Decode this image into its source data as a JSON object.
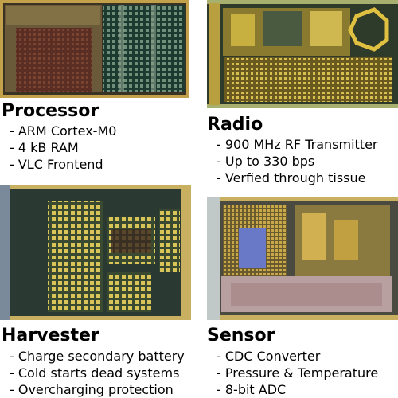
{
  "panels": {
    "processor": {
      "title": "Processor",
      "items": [
        "ARM Cortex-M0",
        "4 kB RAM",
        "VLC Frontend"
      ]
    },
    "radio": {
      "title": "Radio",
      "items": [
        "900 MHz RF Transmitter",
        "Up to 330 bps",
        "Verfied through tissue"
      ]
    },
    "harvester": {
      "title": "Harvester",
      "items": [
        "Charge secondary battery",
        "Cold starts dead systems",
        "Overcharging protection"
      ]
    },
    "sensor": {
      "title": "Sensor",
      "items": [
        "CDC Converter",
        "Pressure & Temperature",
        "8-bit ADC"
      ]
    }
  }
}
